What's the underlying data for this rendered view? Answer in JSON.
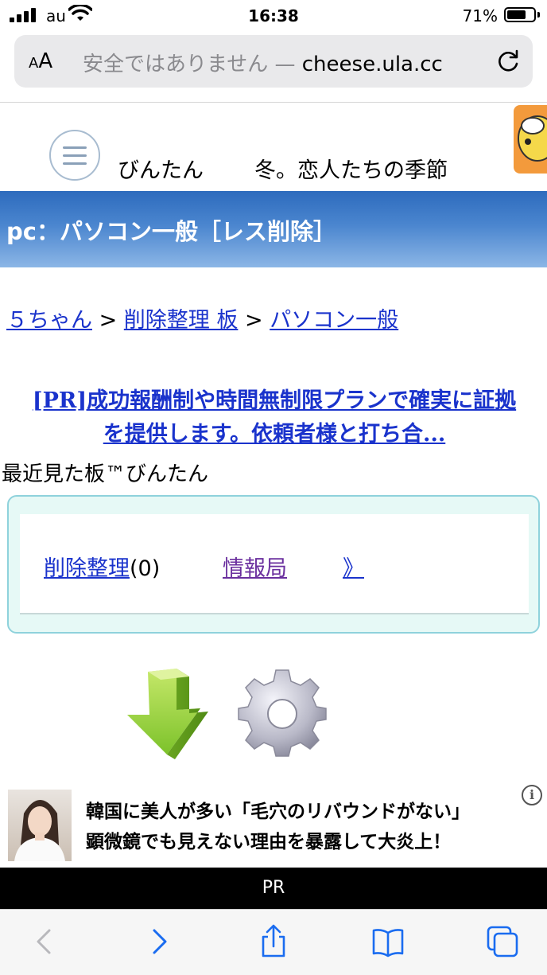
{
  "status_bar": {
    "carrier": "au",
    "time": "16:38",
    "battery_percent": "71%",
    "battery_level": 0.71
  },
  "url_bar": {
    "aa": "AA",
    "insecure_label": "安全ではありません —",
    "domain": "cheese.ula.cc"
  },
  "site": {
    "name": "びんたん",
    "tagline": "冬。恋人たちの季節"
  },
  "banner": {
    "title": "pc：パソコン一般［レス削除］"
  },
  "breadcrumb": {
    "item1": "５ちゃん",
    "sep1": " > ",
    "item2": "削除整理 板",
    "sep2": " > ",
    "item3": "パソコン一般"
  },
  "pr_link": {
    "line1": "[PR]成功報酬制や時間無制限プランで確実に証拠",
    "line2": "を提供します。依頼者様と打ち合..."
  },
  "recent": {
    "heading": "最近見た板™びんたん",
    "link1": "削除整理",
    "link1_count": "(0)",
    "link2": "情報局",
    "more": "》"
  },
  "ad": {
    "line1": "韓国に美人が多い「毛穴のリバウンドがない」",
    "line2": "顕微鏡でも見えない理由を暴露して大炎上！",
    "info": "i",
    "pr_label": "PR"
  },
  "toolbar": {
    "icons": [
      "back-icon",
      "forward-icon",
      "share-icon",
      "bookmarks-icon",
      "tabs-icon"
    ]
  }
}
